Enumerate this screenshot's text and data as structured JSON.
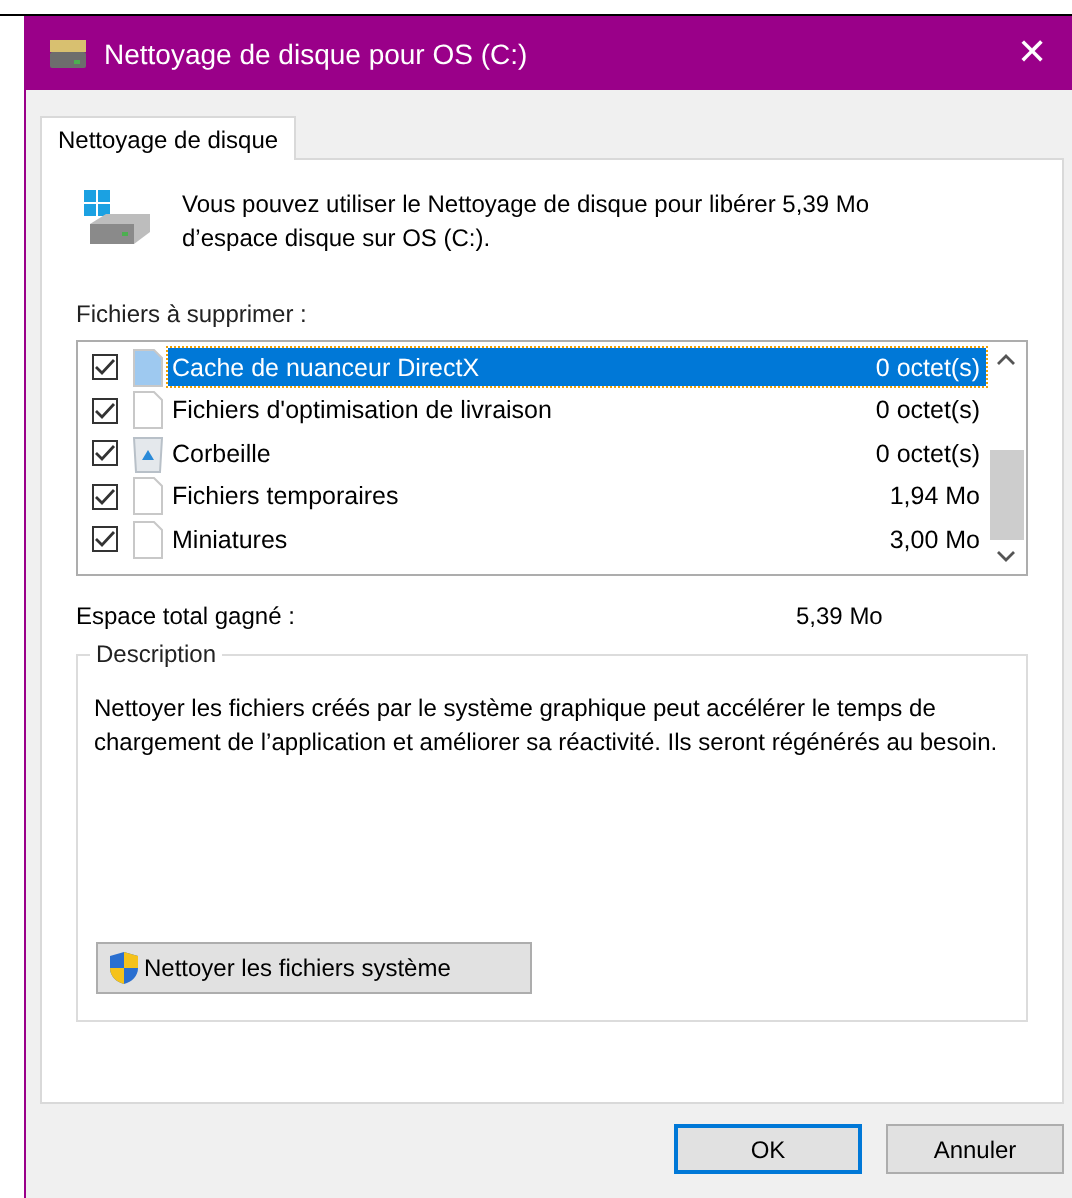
{
  "window": {
    "title": "Nettoyage de disque pour OS (C:)",
    "close": "✕"
  },
  "tabs": [
    {
      "label": "Nettoyage de disque",
      "selected": true
    }
  ],
  "intro": "Vous pouvez utiliser le Nettoyage de disque pour libérer 5,39 Mo d’espace disque sur OS (C:).",
  "files_label": "Fichiers à supprimer :",
  "files": [
    {
      "kind": "file",
      "name": "Cache de nuanceur DirectX",
      "size": "0 octet(s)",
      "checked": true,
      "selected": true
    },
    {
      "kind": "file",
      "name": "Fichiers d'optimisation de livraison",
      "size": "0 octet(s)",
      "checked": true,
      "selected": false
    },
    {
      "kind": "recycle",
      "name": "Corbeille",
      "size": "0 octet(s)",
      "checked": true,
      "selected": false
    },
    {
      "kind": "file",
      "name": "Fichiers temporaires",
      "size": "1,94 Mo",
      "checked": true,
      "selected": false
    },
    {
      "kind": "file",
      "name": "Miniatures",
      "size": "3,00 Mo",
      "checked": true,
      "selected": false
    }
  ],
  "total": {
    "label": "Espace total gagné :",
    "value": "5,39 Mo"
  },
  "description": {
    "title": "Description",
    "text": "Nettoyer les fichiers créés par le système graphique peut accélérer le temps de chargement de l’application et améliorer sa réactivité. Ils seront régénérés au besoin.",
    "button": "Nettoyer les fichiers système"
  },
  "buttons": [
    {
      "label": "OK",
      "default": true
    },
    {
      "label": "Annuler",
      "default": false
    }
  ]
}
